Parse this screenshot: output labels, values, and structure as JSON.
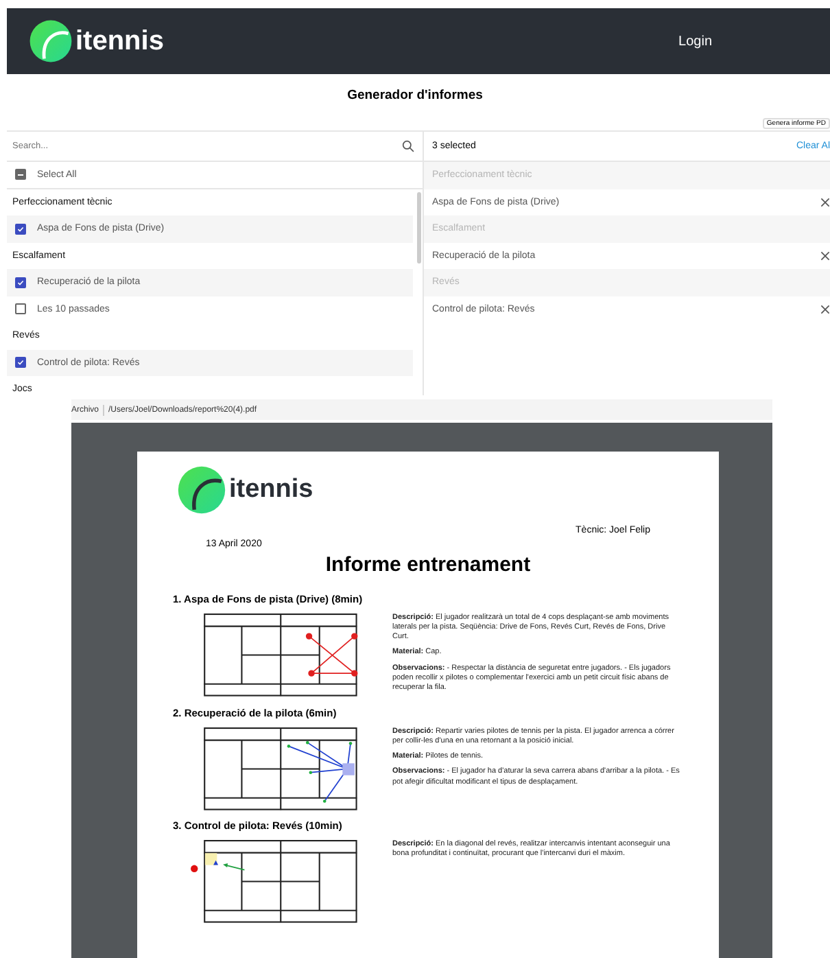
{
  "header": {
    "logo_text": "itennis",
    "login": "Login"
  },
  "page_title": "Generador d'informes",
  "generate_button": "Genera informe PD",
  "selector": {
    "search": {
      "placeholder": "Search..."
    },
    "select_all": {
      "label": "Select All",
      "indeterminate": true
    },
    "groups": [
      {
        "label": "Perfeccionament tècnic",
        "items": [
          {
            "label": "Aspa de Fons de pista (Drive)",
            "checked": true
          }
        ]
      },
      {
        "label": "Escalfament",
        "items": [
          {
            "label": "Recuperació de la pilota",
            "checked": true
          },
          {
            "label": "Les 10 passades",
            "checked": false
          }
        ]
      },
      {
        "label": "Revés",
        "items": [
          {
            "label": "Control de pilota: Revés",
            "checked": true
          }
        ]
      },
      {
        "label": "Jocs"
      }
    ]
  },
  "selected_panel": {
    "count": "3 selected",
    "clear": "Clear Al",
    "entries": [
      {
        "kind": "group",
        "label": "Perfeccionament tècnic"
      },
      {
        "kind": "item",
        "label": "Aspa de Fons de pista (Drive)"
      },
      {
        "kind": "group",
        "label": "Escalfament"
      },
      {
        "kind": "item",
        "label": "Recuperació de la pilota"
      },
      {
        "kind": "group",
        "label": "Revés"
      },
      {
        "kind": "item",
        "label": "Control de pilota: Revés"
      }
    ]
  },
  "pdf_viewer": {
    "location": "Archivo",
    "path": "/Users/Joel/Downloads/report%20(4).pdf"
  },
  "report": {
    "logo_text": "itennis",
    "coach": "Tècnic: Joel Felip",
    "date": "13 April 2020",
    "title": "Informe entrenament",
    "exercises": [
      {
        "heading": "1. Aspa de Fons de pista (Drive) (8min)",
        "kind": "cross",
        "description": "**Descripció:** El jugador realitzarà un total de 4 cops desplaçant-se amb moviments laterals per la pista. Seqüència: Drive de Fons, Revés Curt, Revés de Fons, Drive Curt.",
        "material": "**Material:** Cap.",
        "observations": "**Observacions:** - Respectar la distància de seguretat entre jugadors. - Els jugadors poden recollir x pilotes o complementar l'exercici amb un petit circuit físic abans de recuperar la fila."
      },
      {
        "heading": "2. Recuperació de la pilota (6min)",
        "kind": "collect",
        "description": "**Descripció:** Repartir varies pilotes de tennis per la pista. El jugador arrenca a córrer per collir-les d'una en una retornant a la posició inicial.",
        "material": "**Material:** Pilotes de tennis.",
        "observations": "**Observacions:** - El jugador ha d'aturar la seva carrera abans d'arribar a la pilota. - Es pot afegir dificultat modificant el tipus de desplaçament."
      },
      {
        "heading": "3. Control de pilota: Revés (10min)",
        "kind": "diagonal",
        "description": "**Descripció:** En la diagonal del revés, realitzar intercanvis intentant aconseguir una bona profunditat i continuïtat, procurant que l'intercanvi duri el màxim."
      }
    ]
  }
}
